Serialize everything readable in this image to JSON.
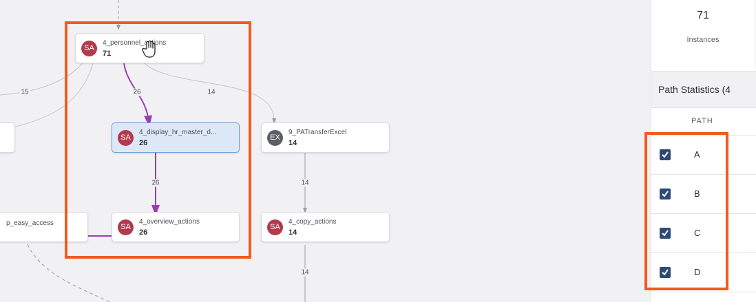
{
  "canvas": {
    "nodes": [
      {
        "id": "n1",
        "badge": "SA",
        "name": "4_personnel_actions",
        "count": "71",
        "selected": false
      },
      {
        "id": "n2",
        "badge": "SA",
        "name": "4_display_hr_master_d...",
        "count": "26",
        "selected": true
      },
      {
        "id": "n3",
        "badge": "EX",
        "name": "9_PATransferExcel",
        "count": "14",
        "selected": false
      },
      {
        "id": "n4",
        "badge": "SA",
        "name": "4_overview_actions",
        "count": "26",
        "selected": false
      },
      {
        "id": "n5",
        "badge": "SA",
        "name": "4_copy_actions",
        "count": "14",
        "selected": false
      },
      {
        "id": "n6",
        "badge": "",
        "name": "p_easy_access",
        "count": "",
        "selected": false
      }
    ],
    "edge_labels": {
      "left_15": "15",
      "n1_n2": "26",
      "n1_n3": "14",
      "n2_n4": "26",
      "n3_n5": "14",
      "n5_down": "14"
    }
  },
  "panel": {
    "instances_value": "71",
    "instances_label": "Instances",
    "path_stats_title": "Path Statistics (4",
    "path_column_header": "PATH",
    "paths": [
      {
        "label": "A",
        "checked": true
      },
      {
        "label": "B",
        "checked": true
      },
      {
        "label": "C",
        "checked": true
      },
      {
        "label": "D",
        "checked": true
      }
    ]
  },
  "colors": {
    "highlight": "#f25a1e",
    "path_edge": "#9b3fb0",
    "badge_sa": "#b23a4c",
    "badge_ex": "#5a5f66",
    "checkbox": "#2e4a73",
    "selected_node": "#dde8f6"
  }
}
